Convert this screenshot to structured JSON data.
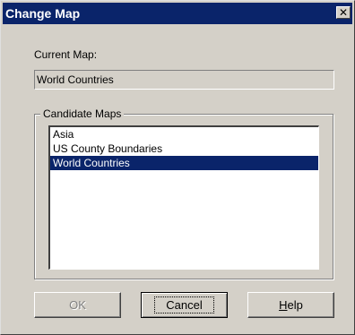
{
  "window": {
    "title": "Change Map",
    "close_glyph": "✕"
  },
  "current_map": {
    "label": "Current Map:",
    "value": "World Countries"
  },
  "candidate_maps": {
    "legend": "Candidate Maps",
    "items": [
      "Asia",
      "US County Boundaries",
      "World Countries"
    ],
    "selected": "World Countries"
  },
  "buttons": {
    "ok": {
      "label": "OK",
      "enabled": false
    },
    "cancel": {
      "label": "Cancel"
    },
    "help": {
      "label": "Help",
      "mnemonic": "H"
    }
  },
  "colors": {
    "title_bar": "#0a246a",
    "selection": "#0a246a",
    "face": "#d4d0c8"
  },
  "icons": {
    "close": "close-icon"
  }
}
